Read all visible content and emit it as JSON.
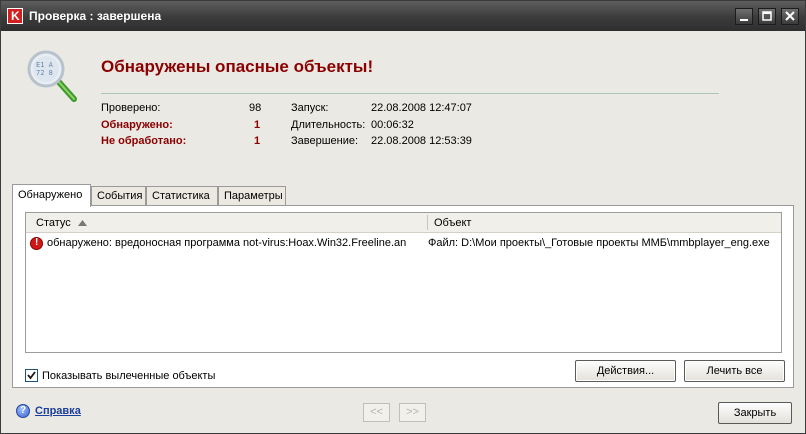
{
  "window": {
    "title": "Проверка : завершена",
    "controls": [
      "minimize-icon",
      "maximize-icon",
      "close-icon"
    ]
  },
  "header": {
    "title": "Обнаружены опасные объекты!",
    "icon": "magnifier-scan-icon"
  },
  "stats": {
    "checked_label": "Проверено:",
    "checked_value": "98",
    "detected_label": "Обнаружено:",
    "detected_value": "1",
    "unprocessed_label": "Не обработано:",
    "unprocessed_value": "1",
    "start_label": "Запуск:",
    "start_value": "22.08.2008 12:47:07",
    "duration_label": "Длительность:",
    "duration_value": "00:06:32",
    "finish_label": "Завершение:",
    "finish_value": "22.08.2008 12:53:39"
  },
  "tabs": [
    {
      "label": "Обнаружено",
      "active": true
    },
    {
      "label": "События",
      "active": false
    },
    {
      "label": "Статистика",
      "active": false
    },
    {
      "label": "Параметры",
      "active": false
    }
  ],
  "table": {
    "columns": [
      "Статус",
      "Объект"
    ],
    "rows": [
      {
        "status": "обнаружено: вредоносная программа not-virus:Hoax.Win32.Freeline.an",
        "object": "Файл: D:\\Мои проекты\\_Готовые проекты ММБ\\mmbplayer_eng.exe",
        "icon": "error-icon"
      }
    ]
  },
  "options": {
    "show_cured_label": "Показывать вылеченные объекты",
    "show_cured_checked": true
  },
  "buttons": {
    "actions": "Действия...",
    "cure_all": "Лечить все",
    "back": "<<",
    "forward": ">>",
    "close": "Закрыть"
  },
  "footer": {
    "help_label": "Справка"
  },
  "colors": {
    "accent_red": "#8b0000",
    "titlebar": "#3b3b3b",
    "link": "#1b3d9b"
  }
}
